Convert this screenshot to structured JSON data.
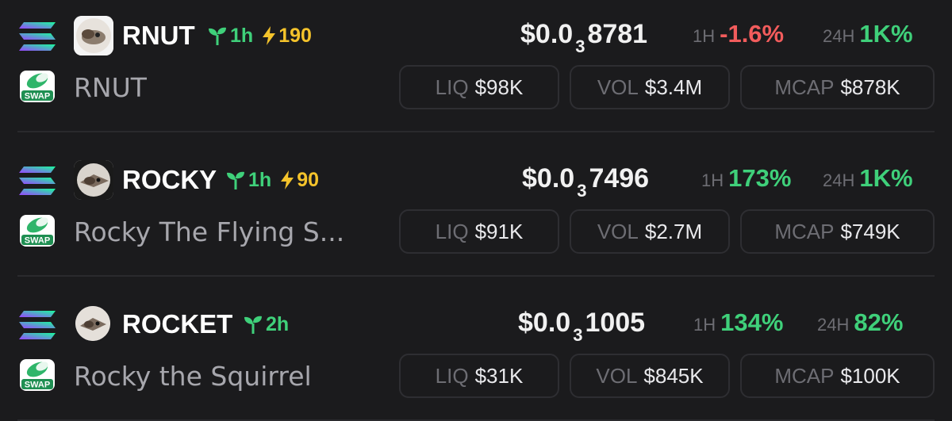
{
  "rows": [
    {
      "ticker": "RNUT",
      "age": "1h",
      "boost": "190",
      "name": "RNUT",
      "price_prefix": "$0.0",
      "price_zeros": "3",
      "price_digits": "8781",
      "h1_label": "1H",
      "h1_change": "-1.6%",
      "h24_label": "24H",
      "h24_change": "1K%",
      "liq_label": "LIQ",
      "liq_value": "$98K",
      "vol_label": "VOL",
      "vol_value": "$3.4M",
      "mcap_label": "MCAP",
      "mcap_value": "$878K"
    },
    {
      "ticker": "ROCKY",
      "age": "1h",
      "boost": "90",
      "name": "Rocky The Flying S...",
      "price_prefix": "$0.0",
      "price_zeros": "3",
      "price_digits": "7496",
      "h1_label": "1H",
      "h1_change": "173%",
      "h24_label": "24H",
      "h24_change": "1K%",
      "liq_label": "LIQ",
      "liq_value": "$91K",
      "vol_label": "VOL",
      "vol_value": "$2.7M",
      "mcap_label": "MCAP",
      "mcap_value": "$749K"
    },
    {
      "ticker": "ROCKET",
      "age": "2h",
      "name": "Rocky the Squirrel",
      "price_prefix": "$0.0",
      "price_zeros": "3",
      "price_digits": "1005",
      "h1_label": "1H",
      "h1_change": "134%",
      "h24_label": "24H",
      "h24_change": "82%",
      "liq_label": "LIQ",
      "liq_value": "$31K",
      "vol_label": "VOL",
      "vol_value": "$845K",
      "mcap_label": "MCAP",
      "mcap_value": "$100K"
    }
  ],
  "swap_badge_text": "SWAP",
  "icons": {
    "chain": "solana-icon",
    "dex": "swap-dex-icon",
    "age": "sprout-icon",
    "boost": "lightning-icon"
  },
  "colors": {
    "positive": "#3fd07a",
    "negative": "#f25c5c",
    "boost": "#f4c32b"
  }
}
